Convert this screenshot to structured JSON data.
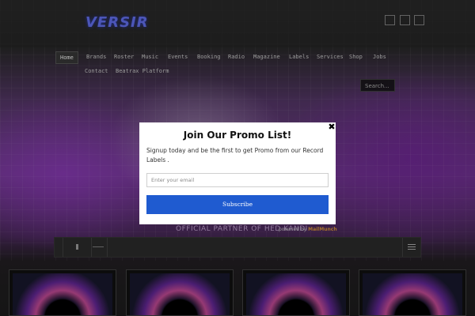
{
  "header": {
    "logo_text": "VERSIR",
    "social_icons": [
      "social-icon-1",
      "social-icon-2",
      "social-icon-3"
    ]
  },
  "nav": {
    "items": [
      {
        "label": "Home",
        "active": true
      },
      {
        "label": "Brands"
      },
      {
        "label": "Roster"
      },
      {
        "label": "Music"
      },
      {
        "label": "Events"
      },
      {
        "label": "Booking"
      },
      {
        "label": "Radio"
      },
      {
        "label": "Magazine"
      },
      {
        "label": "Labels"
      },
      {
        "label": "Services"
      },
      {
        "label": "Shop"
      },
      {
        "label": "Jobs"
      },
      {
        "label": "Contact"
      },
      {
        "label": "Beatrax Platform"
      }
    ],
    "search_placeholder": "Search..."
  },
  "hero": {
    "tagline": "OFFICIAL PARTNER OF HED KANDI",
    "powered_by_prefix": "powered by",
    "powered_by_brand": "MailMunch"
  },
  "modal": {
    "close_icon": "close-icon",
    "title": "Join Our Promo List!",
    "description": "Signup today and be the first to get Promo from our Record Labels .",
    "email_placeholder": "Enter your email",
    "submit_label": "Subscribe",
    "accent_color": "#1f5bd0"
  },
  "player": {
    "play_icon": "play-icon",
    "menu_icon": "menu-icon"
  },
  "cards_count": 4
}
